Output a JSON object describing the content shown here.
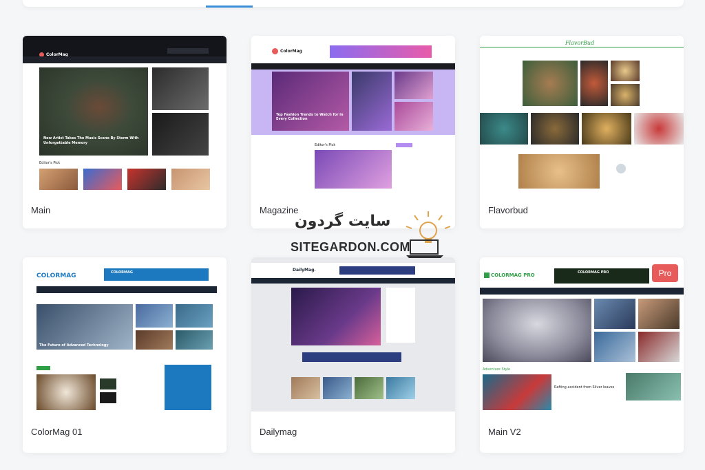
{
  "cards": [
    {
      "label": "Main",
      "site_name": "ColorMag"
    },
    {
      "label": "Magazine",
      "site_name": "ColorMag",
      "headline": "Top Fashion Trends to Watch for in Every Collection",
      "editors_pick": "Editor's Pick"
    },
    {
      "label": "Flavorbud",
      "site_name": "FlavorBud"
    },
    {
      "label": "ColorMag 01",
      "site_name": "COLORMAG",
      "ad_name": "COLORMAG"
    },
    {
      "label": "Dailymag",
      "site_name": "DailyMag."
    },
    {
      "label": "Main V2",
      "site_name": "COLORMAG PRO",
      "badge": "Pro",
      "ad_name": "COLORMAG PRO"
    }
  ],
  "main_card": {
    "headline": "New Artist Takes The Music Scene By Storm With Unforgettable Memory",
    "section": "Editor's Pick"
  },
  "colormag01_card": {
    "headline": "The Future of Advanced Technology"
  },
  "mainv2_card": {
    "section": "Adventure Style",
    "headline": "Rafting accident from Silver leaves"
  },
  "watermark": {
    "fa": "سایت گردون",
    "en": "SITEGARDON.COM"
  },
  "colors": {
    "accent": "#3a8fd6",
    "pro_badge": "#e85b5b",
    "magazine_purple": "#b28cf0",
    "colormag_blue": "#1c79c0",
    "mainv2_green": "#2f9e44"
  },
  "icons": [
    "sun-lightbulb-icon",
    "laptop-icon",
    "search-icon"
  ]
}
